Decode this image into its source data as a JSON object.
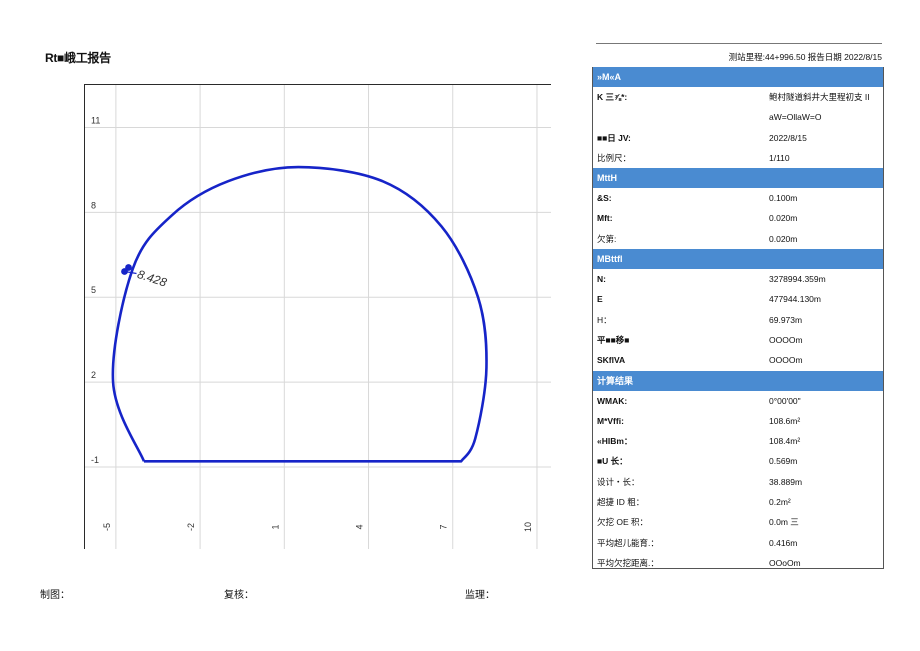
{
  "header": {
    "title": "Rt■峨工报告",
    "station_info": "测站里程:44+996.50 报告日期 2022/8/15"
  },
  "chart_data": {
    "type": "line",
    "title": "",
    "xlabel": "",
    "ylabel": "",
    "x_ticks": [
      "-5",
      "-2",
      "1",
      "4",
      "7",
      "10"
    ],
    "y_ticks": [
      "11",
      "8",
      "5",
      "2",
      "-1"
    ],
    "xlim": [
      -6.1,
      10.5
    ],
    "ylim": [
      -3.9,
      12.5
    ],
    "grid": true,
    "annotation": "8.428",
    "series": [
      {
        "values": [
          [
            -4.0,
            -0.8
          ],
          [
            -5.1,
            2.0
          ],
          [
            -4.4,
            6.0
          ],
          [
            -3.0,
            7.9
          ],
          [
            -1.0,
            9.1
          ],
          [
            1.5,
            9.6
          ],
          [
            4.5,
            9.1
          ],
          [
            6.6,
            7.5
          ],
          [
            7.9,
            5.0
          ],
          [
            8.2,
            2.5
          ],
          [
            7.8,
            0.0
          ],
          [
            7.3,
            -0.8
          ],
          [
            -4.0,
            -0.8
          ]
        ]
      }
    ]
  },
  "panel": {
    "sections": [
      {
        "header": "»M«A",
        "rows": [
          {
            "label": "K 三⅞*:",
            "value": "鲍村隧道斜井大里程初支 II",
            "bold": true
          },
          {
            "label": "",
            "value": "aW=OllaW=O",
            "bold": false
          },
          {
            "label": "■■日 JV:",
            "value": "2022/8/15",
            "bold": true
          },
          {
            "label": "比例尺：",
            "value": "1/110",
            "bold": false
          }
        ]
      },
      {
        "header": "MttH",
        "rows": [
          {
            "label": "&S:",
            "value": "0.100m",
            "bold": true
          },
          {
            "label": "Mft:",
            "value": "0.020m",
            "bold": true
          },
          {
            "label": "欠第:",
            "value": "0.020m",
            "bold": false
          }
        ]
      },
      {
        "header": "MBttfl",
        "rows": [
          {
            "label": "N:",
            "value": "3278994.359m",
            "bold": true
          },
          {
            "label": "E",
            "value": "477944.130m",
            "bold": true
          },
          {
            "label": "H：",
            "value": "69.973m",
            "bold": false
          },
          {
            "label": "平■■移■",
            "value": "OOOOm",
            "bold": true
          },
          {
            "label": "SKflVA",
            "value": "OOOOm",
            "bold": true
          }
        ]
      },
      {
        "header": "计算结果",
        "rows": [
          {
            "label": "WMAK:",
            "value": "0°00'00\"",
            "bold": true
          },
          {
            "label": "M*Vffi:",
            "value": "108.6m²",
            "bold": true
          },
          {
            "label": "«HIBm：",
            "value": "108.4m²",
            "bold": true
          },
          {
            "label": "■U 长：",
            "value": "0.569m",
            "bold": true
          },
          {
            "label": "设计・长：",
            "value": "38.889m",
            "bold": false
          },
          {
            "label": "超捷 ID 粗：",
            "value": "0.2m²",
            "bold": false
          },
          {
            "label": "欠挖 OE 积：",
            "value": "0.0m 三",
            "bold": false
          },
          {
            "label": "平均超儿能育.：",
            "value": "0.416m",
            "bold": false
          },
          {
            "label": "平均欠挖距离.：",
            "value": "OOoOm",
            "bold": false
          }
        ]
      }
    ]
  },
  "footer": {
    "drafter": "制图：",
    "reviewer": "复核：",
    "supervisor": "监理："
  }
}
